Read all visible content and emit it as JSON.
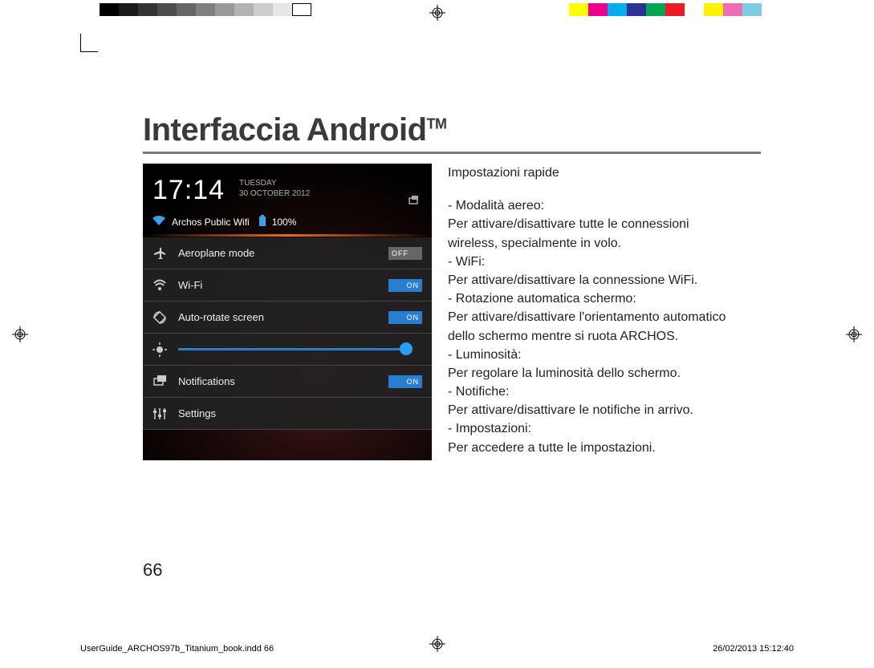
{
  "title_main": "Interfaccia Android",
  "title_tm": "TM",
  "page_number": "66",
  "screenshot": {
    "time": "17:14",
    "date_line1": "TUESDAY",
    "date_line2": "30 OCTOBER 2012",
    "wifi_name": "Archos Public Wifi",
    "battery": "100%",
    "rows": {
      "aeroplane": {
        "label": "Aeroplane mode",
        "toggle": "OFF"
      },
      "wifi": {
        "label": "Wi-Fi",
        "toggle": "ON"
      },
      "autorotate": {
        "label": "Auto-rotate screen",
        "toggle": "ON"
      },
      "brightness": {
        "label": ""
      },
      "notifications": {
        "label": "Notifications",
        "toggle": "ON"
      },
      "settings": {
        "label": "Settings"
      }
    }
  },
  "text": {
    "subhead": "Impostazioni rapide",
    "l1": "- Modalità aereo:",
    "l2": "Per attivare/disattivare tutte le connessioni",
    "l3": "wireless, specialmente in volo.",
    "l4": "- WiFi:",
    "l5": "Per attivare/disattivare la connessione WiFi.",
    "l6": "- Rotazione automatica schermo:",
    "l7": "Per attivare/disattivare l'orientamento automatico",
    "l8": "dello schermo mentre si ruota ARCHOS.",
    "l9": "- Luminosità:",
    "l10": "Per regolare la luminosità dello schermo.",
    "l11": "- Notifiche:",
    "l12": "Per attivare/disattivare le notifiche in arrivo.",
    "l13": "- Impostazioni:",
    "l14": "Per accedere a tutte le impostazioni."
  },
  "slug_file": "UserGuide_ARCHOS97b_Titanium_book.indd   66",
  "slug_date": "26/02/2013   15:12:40",
  "printer_colors": {
    "gray": [
      "#000000",
      "#1a1a1a",
      "#333333",
      "#4d4d4d",
      "#666666",
      "#808080",
      "#999999",
      "#b3b3b3",
      "#cccccc",
      "#e6e6e6",
      "#ffffff"
    ],
    "color": [
      "#ffff00",
      "#ec008c",
      "#00aeef",
      "#2e3192",
      "#00a651",
      "#ed1c24",
      "#ffffff",
      "#fff200",
      "#ec6eb0",
      "#7ecce4",
      "#ffffff"
    ]
  }
}
